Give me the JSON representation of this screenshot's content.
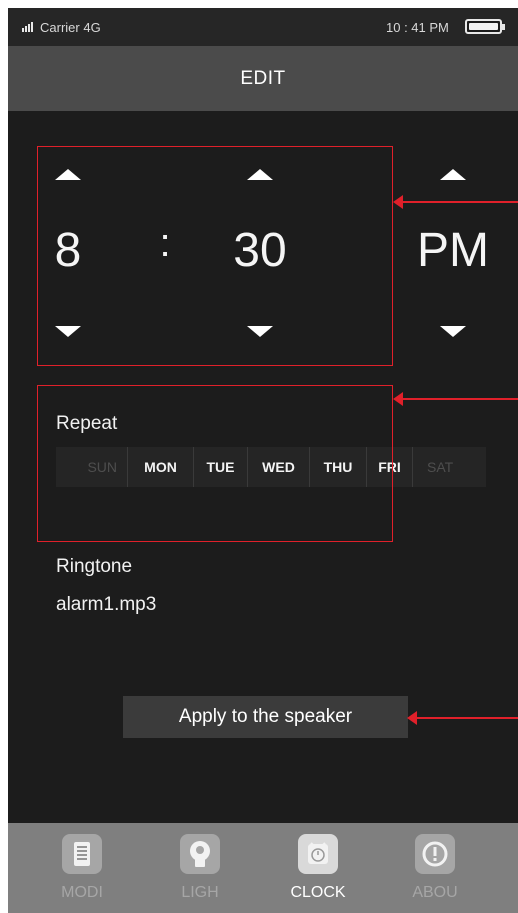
{
  "status_bar": {
    "carrier": "Carrier 4G",
    "time": "10 : 41 PM",
    "battery_level": 1.0
  },
  "header": {
    "title": "EDIT"
  },
  "time_picker": {
    "hour": "8",
    "separator": ":",
    "minute": "30",
    "period": "PM"
  },
  "repeat": {
    "label": "Repeat",
    "days": [
      {
        "label": "SUN",
        "selected": false
      },
      {
        "label": "MON",
        "selected": true
      },
      {
        "label": "TUE",
        "selected": true
      },
      {
        "label": "WED",
        "selected": true
      },
      {
        "label": "THU",
        "selected": true
      },
      {
        "label": "FRI",
        "selected": true
      },
      {
        "label": "SAT",
        "selected": false
      }
    ]
  },
  "ringtone": {
    "label": "Ringtone",
    "value": "alarm1.mp3"
  },
  "apply_button": {
    "label": "Apply to the speaker"
  },
  "annotation_color": "#e0202a",
  "tab_bar": {
    "tabs": [
      {
        "label": "MODI",
        "icon": "document-icon",
        "active": false
      },
      {
        "label": "LIGH",
        "icon": "bulb-icon",
        "active": false
      },
      {
        "label": "CLOCK",
        "icon": "alarm-clock-icon",
        "active": true
      },
      {
        "label": "ABOU",
        "icon": "info-icon",
        "active": false
      }
    ]
  }
}
